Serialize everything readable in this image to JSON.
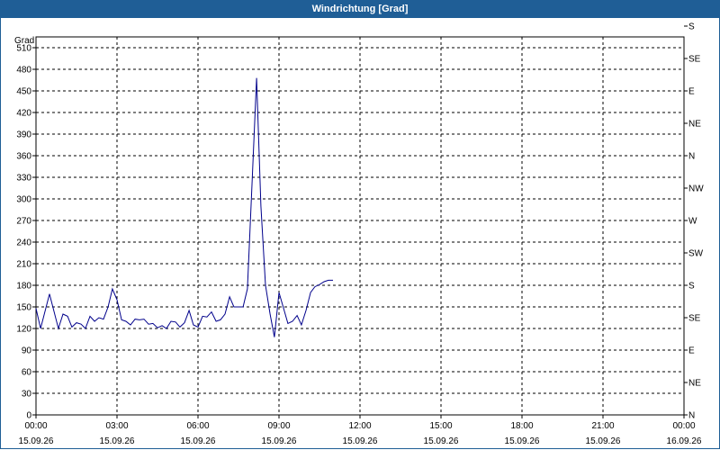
{
  "window": {
    "title": "Windrichtung [Grad]"
  },
  "chart_data": {
    "type": "line",
    "title": "Windrichtung [Grad]",
    "ylabel": "Grad",
    "ylim": [
      0,
      525
    ],
    "y_ticks": [
      0,
      30,
      60,
      90,
      120,
      150,
      180,
      210,
      240,
      270,
      300,
      330,
      360,
      390,
      420,
      450,
      480,
      510
    ],
    "right_axis_labels": [
      "N",
      "NE",
      "E",
      "SE",
      "S",
      "SW",
      "W",
      "NW",
      "N",
      "NE",
      "E",
      "SE",
      "S"
    ],
    "x_ticks": [
      {
        "time": "00:00",
        "date": "15.09.26"
      },
      {
        "time": "03:00",
        "date": "15.09.26"
      },
      {
        "time": "06:00",
        "date": "15.09.26"
      },
      {
        "time": "09:00",
        "date": "15.09.26"
      },
      {
        "time": "12:00",
        "date": "15.09.26"
      },
      {
        "time": "15:00",
        "date": "15.09.26"
      },
      {
        "time": "18:00",
        "date": "15.09.26"
      },
      {
        "time": "21:00",
        "date": "15.09.26"
      },
      {
        "time": "00:00",
        "date": "16.09.26"
      }
    ],
    "x_range_hours": [
      0,
      24
    ],
    "grid": true,
    "series": [
      {
        "color": "#00008b",
        "x": [
          0,
          0.17,
          0.5,
          0.83,
          1.0,
          1.17,
          1.33,
          1.5,
          1.67,
          1.83,
          2.0,
          2.17,
          2.33,
          2.5,
          2.67,
          2.83,
          3.0,
          3.17,
          3.33,
          3.5,
          3.67,
          3.83,
          4.0,
          4.17,
          4.33,
          4.5,
          4.67,
          4.83,
          5.0,
          5.17,
          5.33,
          5.5,
          5.67,
          5.83,
          6.0,
          6.17,
          6.33,
          6.5,
          6.67,
          6.83,
          7.0,
          7.17,
          7.33,
          7.5,
          7.67,
          7.83,
          8.0,
          8.17,
          8.33,
          8.5,
          8.67,
          8.83,
          9.0,
          9.17,
          9.33,
          9.5,
          9.67,
          9.83,
          10.0,
          10.17,
          10.33,
          10.5,
          10.67,
          10.83,
          11.0
        ],
        "y": [
          148,
          120,
          168,
          120,
          140,
          137,
          122,
          128,
          126,
          120,
          137,
          130,
          135,
          133,
          150,
          175,
          160,
          132,
          130,
          125,
          133,
          132,
          133,
          126,
          127,
          121,
          124,
          120,
          130,
          129,
          122,
          128,
          145,
          125,
          122,
          137,
          136,
          143,
          130,
          132,
          140,
          164,
          150,
          150,
          150,
          175,
          320,
          468,
          290,
          180,
          140,
          108,
          170,
          148,
          127,
          130,
          138,
          125,
          145,
          170,
          178,
          181,
          185,
          187,
          187
        ]
      }
    ]
  }
}
